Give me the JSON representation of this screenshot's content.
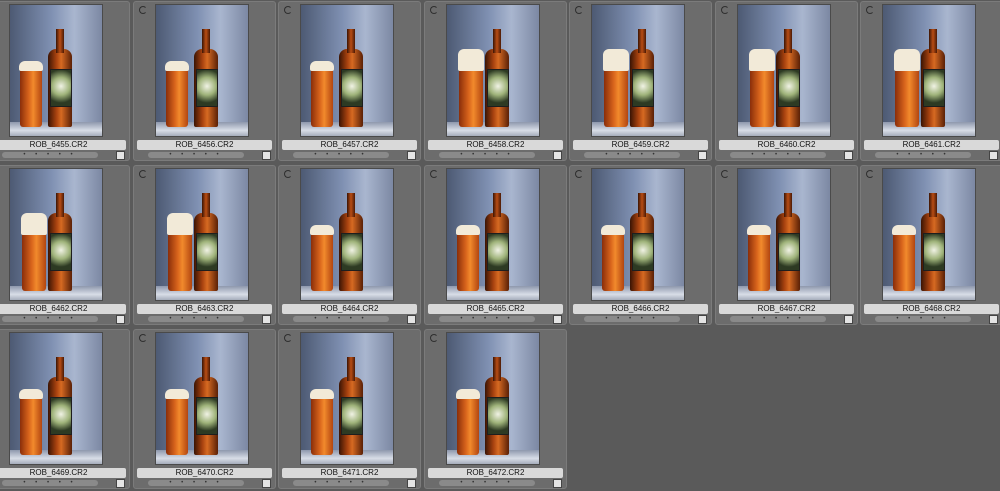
{
  "filmstrip": {
    "thumbnails": [
      {
        "filename": "ROB_6455.CR2",
        "rating_dots": "• • • • •",
        "foam": "low"
      },
      {
        "filename": "ROB_6456.CR2",
        "rating_dots": "• • • • •",
        "foam": "low"
      },
      {
        "filename": "ROB_6457.CR2",
        "rating_dots": "• • • • •",
        "foam": "low"
      },
      {
        "filename": "ROB_6458.CR2",
        "rating_dots": "• • • • •",
        "foam": "high"
      },
      {
        "filename": "ROB_6459.CR2",
        "rating_dots": "• • • • •",
        "foam": "high"
      },
      {
        "filename": "ROB_6460.CR2",
        "rating_dots": "• • • • •",
        "foam": "high"
      },
      {
        "filename": "ROB_6461.CR2",
        "rating_dots": "• • • • •",
        "foam": "high"
      },
      {
        "filename": "ROB_6462.CR2",
        "rating_dots": "• • • • •",
        "foam": "high"
      },
      {
        "filename": "ROB_6463.CR2",
        "rating_dots": "• • • • •",
        "foam": "high"
      },
      {
        "filename": "ROB_6464.CR2",
        "rating_dots": "• • • • •",
        "foam": "low"
      },
      {
        "filename": "ROB_6465.CR2",
        "rating_dots": "• • • • •",
        "foam": "low"
      },
      {
        "filename": "ROB_6466.CR2",
        "rating_dots": "• • • • •",
        "foam": "low"
      },
      {
        "filename": "ROB_6467.CR2",
        "rating_dots": "• • • • •",
        "foam": "low"
      },
      {
        "filename": "ROB_6468.CR2",
        "rating_dots": "• • • • •",
        "foam": "low"
      },
      {
        "filename": "ROB_6469.CR2",
        "rating_dots": "• • • • •",
        "foam": "low"
      },
      {
        "filename": "ROB_6470.CR2",
        "rating_dots": "• • • • •",
        "foam": "low"
      },
      {
        "filename": "ROB_6471.CR2",
        "rating_dots": "• • • • •",
        "foam": "low"
      },
      {
        "filename": "ROB_6472.CR2",
        "rating_dots": "• • • • •",
        "foam": "low"
      }
    ]
  },
  "icons": {
    "sync": "sync-badge-icon",
    "flag": "pick-flag-icon"
  },
  "colors": {
    "background": "#5a5a5a",
    "cell": "#6c6c6c",
    "caption": "#d9d9d9"
  }
}
